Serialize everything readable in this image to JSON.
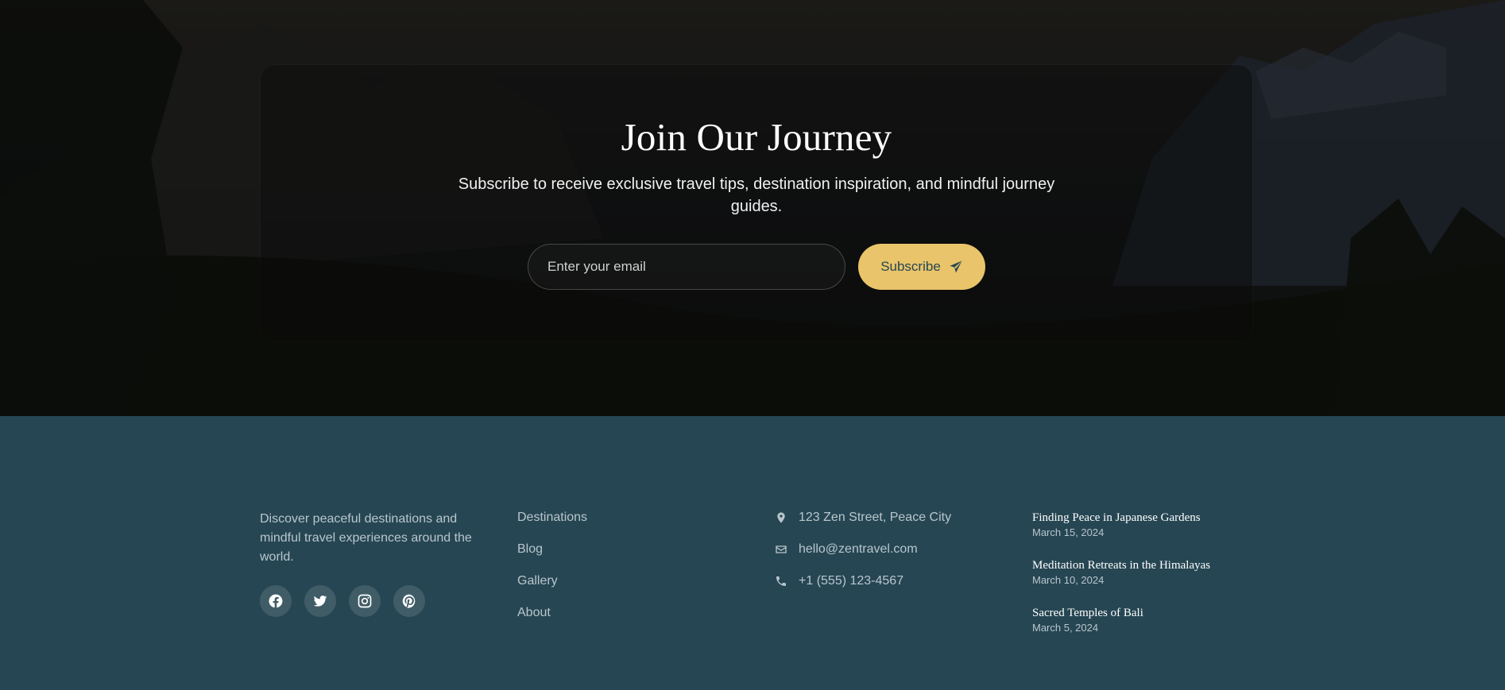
{
  "newsletter": {
    "title": "Join Our Journey",
    "subtitle": "Subscribe to receive exclusive travel tips, destination inspiration, and mindful journey guides.",
    "email_placeholder": "Enter your email",
    "subscribe_label": "Subscribe",
    "subscribe_icon": "paper-plane-icon"
  },
  "footer": {
    "about": "Discover peaceful destinations and mindful travel experiences around the world.",
    "social": [
      {
        "name": "facebook-icon"
      },
      {
        "name": "twitter-icon"
      },
      {
        "name": "instagram-icon"
      },
      {
        "name": "pinterest-icon"
      }
    ],
    "links": [
      "Destinations",
      "Blog",
      "Gallery",
      "About"
    ],
    "contact": {
      "address": "123 Zen Street, Peace City",
      "email": "hello@zentravel.com",
      "phone": "+1 (555) 123-4567"
    },
    "posts": [
      {
        "title": "Finding Peace in Japanese Gardens",
        "date": "March 15, 2024"
      },
      {
        "title": "Meditation Retreats in the Himalayas",
        "date": "March 10, 2024"
      },
      {
        "title": "Sacred Temples of Bali",
        "date": "March 5, 2024"
      }
    ]
  },
  "colors": {
    "footer_bg": "#264653",
    "accent": "#e9c46a",
    "muted_text": "#b9c6cc"
  }
}
